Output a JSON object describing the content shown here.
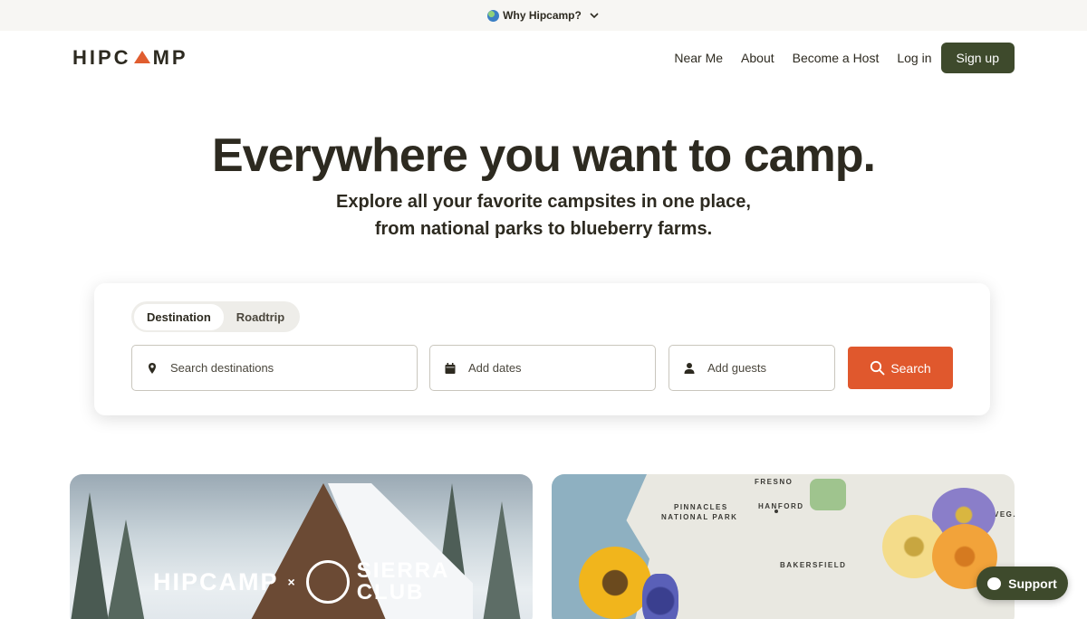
{
  "banner": {
    "text": "Why Hipcamp?",
    "icons": [
      "globe-icon",
      "chevron-down-icon"
    ]
  },
  "header": {
    "logo": {
      "before": "HIPC",
      "after": "MP"
    },
    "nav": [
      "Near Me",
      "About",
      "Become a Host",
      "Log in"
    ],
    "signup": "Sign up"
  },
  "hero": {
    "title": "Everywhere you want to camp.",
    "subtitle_line1": "Explore all your favorite campsites in one place,",
    "subtitle_line2": "from national parks to blueberry farms."
  },
  "search": {
    "tabs": [
      {
        "label": "Destination",
        "active": true
      },
      {
        "label": "Roadtrip",
        "active": false
      }
    ],
    "destination_placeholder": "Search destinations",
    "dates_placeholder": "Add dates",
    "guests_placeholder": "Add guests",
    "button": "Search"
  },
  "promo_left": {
    "brand": "HIPCAMP",
    "x": "×",
    "partner_line1": "SIERRA",
    "partner_line2": "CLUB"
  },
  "promo_right": {
    "labels": [
      "FRESNO",
      "PINNACLES",
      "NATIONAL PARK",
      "HANFORD",
      "BAKERSFIELD",
      "VEG."
    ]
  },
  "support": {
    "label": "Support"
  },
  "colors": {
    "accent": "#e0582d",
    "brand_green": "#3e4a2c",
    "text": "#2d2a20"
  }
}
